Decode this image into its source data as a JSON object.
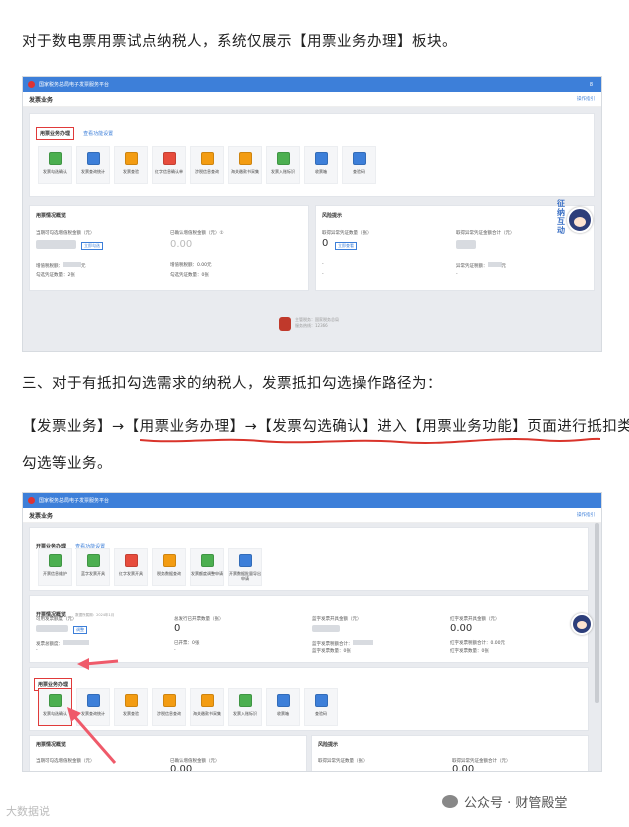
{
  "para1": "对于数电票用票试点纳税人，系统仅展示【用票业务办理】板块。",
  "para2": "三、对于有抵扣勾选需求的纳税人，发票抵扣勾选操作路径为：",
  "para3": "【发票业务】→【用票业务办理】→【发票勾选确认】进入【用票业务功能】页面进行抵扣类",
  "para3b": "勾选等业务。",
  "shot1": {
    "app_title": "国家税务总局电子发票服务平台",
    "user": "8",
    "page_title": "发票业务",
    "right_link": "操作指引",
    "section_title": "用票业务办理",
    "section_link": "查看功能设置",
    "icons": [
      {
        "label": "发票勾选确认",
        "color": "#4caf50"
      },
      {
        "label": "发票查询统计",
        "color": "#3d7fd9"
      },
      {
        "label": "发票查验",
        "color": "#f39c12"
      },
      {
        "label": "红字信息确认单",
        "color": "#e74c3c"
      },
      {
        "label": "涉税信息查询",
        "color": "#f39c12"
      },
      {
        "label": "海关缴款书采集",
        "color": "#f39c12"
      },
      {
        "label": "发票入账标识",
        "color": "#4caf50"
      },
      {
        "label": "收票箱",
        "color": "#3d7fd9"
      },
      {
        "label": "查验码",
        "color": "#3d7fd9"
      }
    ],
    "overview_title": "用票情况概览",
    "ov_label1": "当期可勾选增值税金额（元）",
    "ov_btn1": "立即勾选",
    "ov_label2": "已确认增值税金额（元）①",
    "ov_val2": "0.00",
    "ov_row1a": "增值税税额：",
    "ov_row1b": "元",
    "ov_row2a": "增值税税额：",
    "ov_row2b": "0.00元",
    "ov_row3a": "勾选凭证数量：",
    "ov_row3b": "2张",
    "ov_row4a": "勾选凭证数量：",
    "ov_row4b": "0张",
    "risk_title": "风险提示",
    "risk_label1": "取得异常凭证数量（张）",
    "risk_val1": "0",
    "risk_btn1": "立即查看",
    "risk_label2": "取得异常凭证金额合计（元）",
    "risk_row1": "异常凭证税额：",
    "risk_row1b": "元",
    "risk_dash": "-",
    "footer1": "主管税务：国家税务总局",
    "footer2": "服务热线：12366",
    "bubble": "征 纳 互 动"
  },
  "shot2": {
    "app_title": "国家税务总局电子发票服务平台",
    "page_title": "发票业务",
    "right_link": "操作指引",
    "kp_title": "开票业务办理",
    "kp_link": "查看功能设置",
    "kp_icons": [
      {
        "label": "开票信息维护",
        "color": "#4caf50"
      },
      {
        "label": "蓝字发票开具",
        "color": "#4caf50"
      },
      {
        "label": "红字发票开具",
        "color": "#e74c3c"
      },
      {
        "label": "税务数据查询",
        "color": "#f39c12"
      },
      {
        "label": "发票额度调整申请",
        "color": "#4caf50"
      },
      {
        "label": "开票数据批量导出申请",
        "color": "#3d7fd9"
      }
    ],
    "kp_overview_title": "开票情况概览",
    "kp_period": "数据所属期：2024年1月",
    "c1_label": "可用发票额度（元）",
    "c1_btn": "调整",
    "c2_label": "总发行已开票数量（张）",
    "c2_val": "0",
    "c3_label": "蓝字发票开具金额（元）",
    "c4_label": "红字发票开具金额（元）",
    "c4_val": "0.00",
    "r1a": "发票总额度：",
    "r2a": "已开票：0张",
    "r3a": "蓝字发票税额合计：",
    "r4a": "红字发票税额合计：0.00元",
    "r5a": "蓝字发票数量：0张",
    "r6a": "红字发票数量：0张",
    "dash": "-",
    "yp_title": "用票业务办理",
    "yp_icons": [
      {
        "label": "发票勾选确认",
        "color": "#4caf50"
      },
      {
        "label": "发票查询统计",
        "color": "#3d7fd9"
      },
      {
        "label": "发票查验",
        "color": "#f39c12"
      },
      {
        "label": "涉税信息查询",
        "color": "#f39c12"
      },
      {
        "label": "海关缴款书采集",
        "color": "#f39c12"
      },
      {
        "label": "发票入账标识",
        "color": "#4caf50"
      },
      {
        "label": "收票箱",
        "color": "#3d7fd9"
      },
      {
        "label": "查验码",
        "color": "#3d7fd9"
      }
    ],
    "yp_overview_title": "用票情况概览",
    "yp_label1": "当期可勾选增值税金额（元）",
    "yp_label2": "已确认增值税金额（元）",
    "yp_val2": "0.00",
    "risk_title": "风险提示",
    "risk_label1": "取得异常凭证数量（张）",
    "risk_label2": "取得异常凭证金额合计（元）",
    "risk_val2": "0.00"
  },
  "watermark_left": "大数据说",
  "watermark_right": "公众号 · 财管殿堂"
}
